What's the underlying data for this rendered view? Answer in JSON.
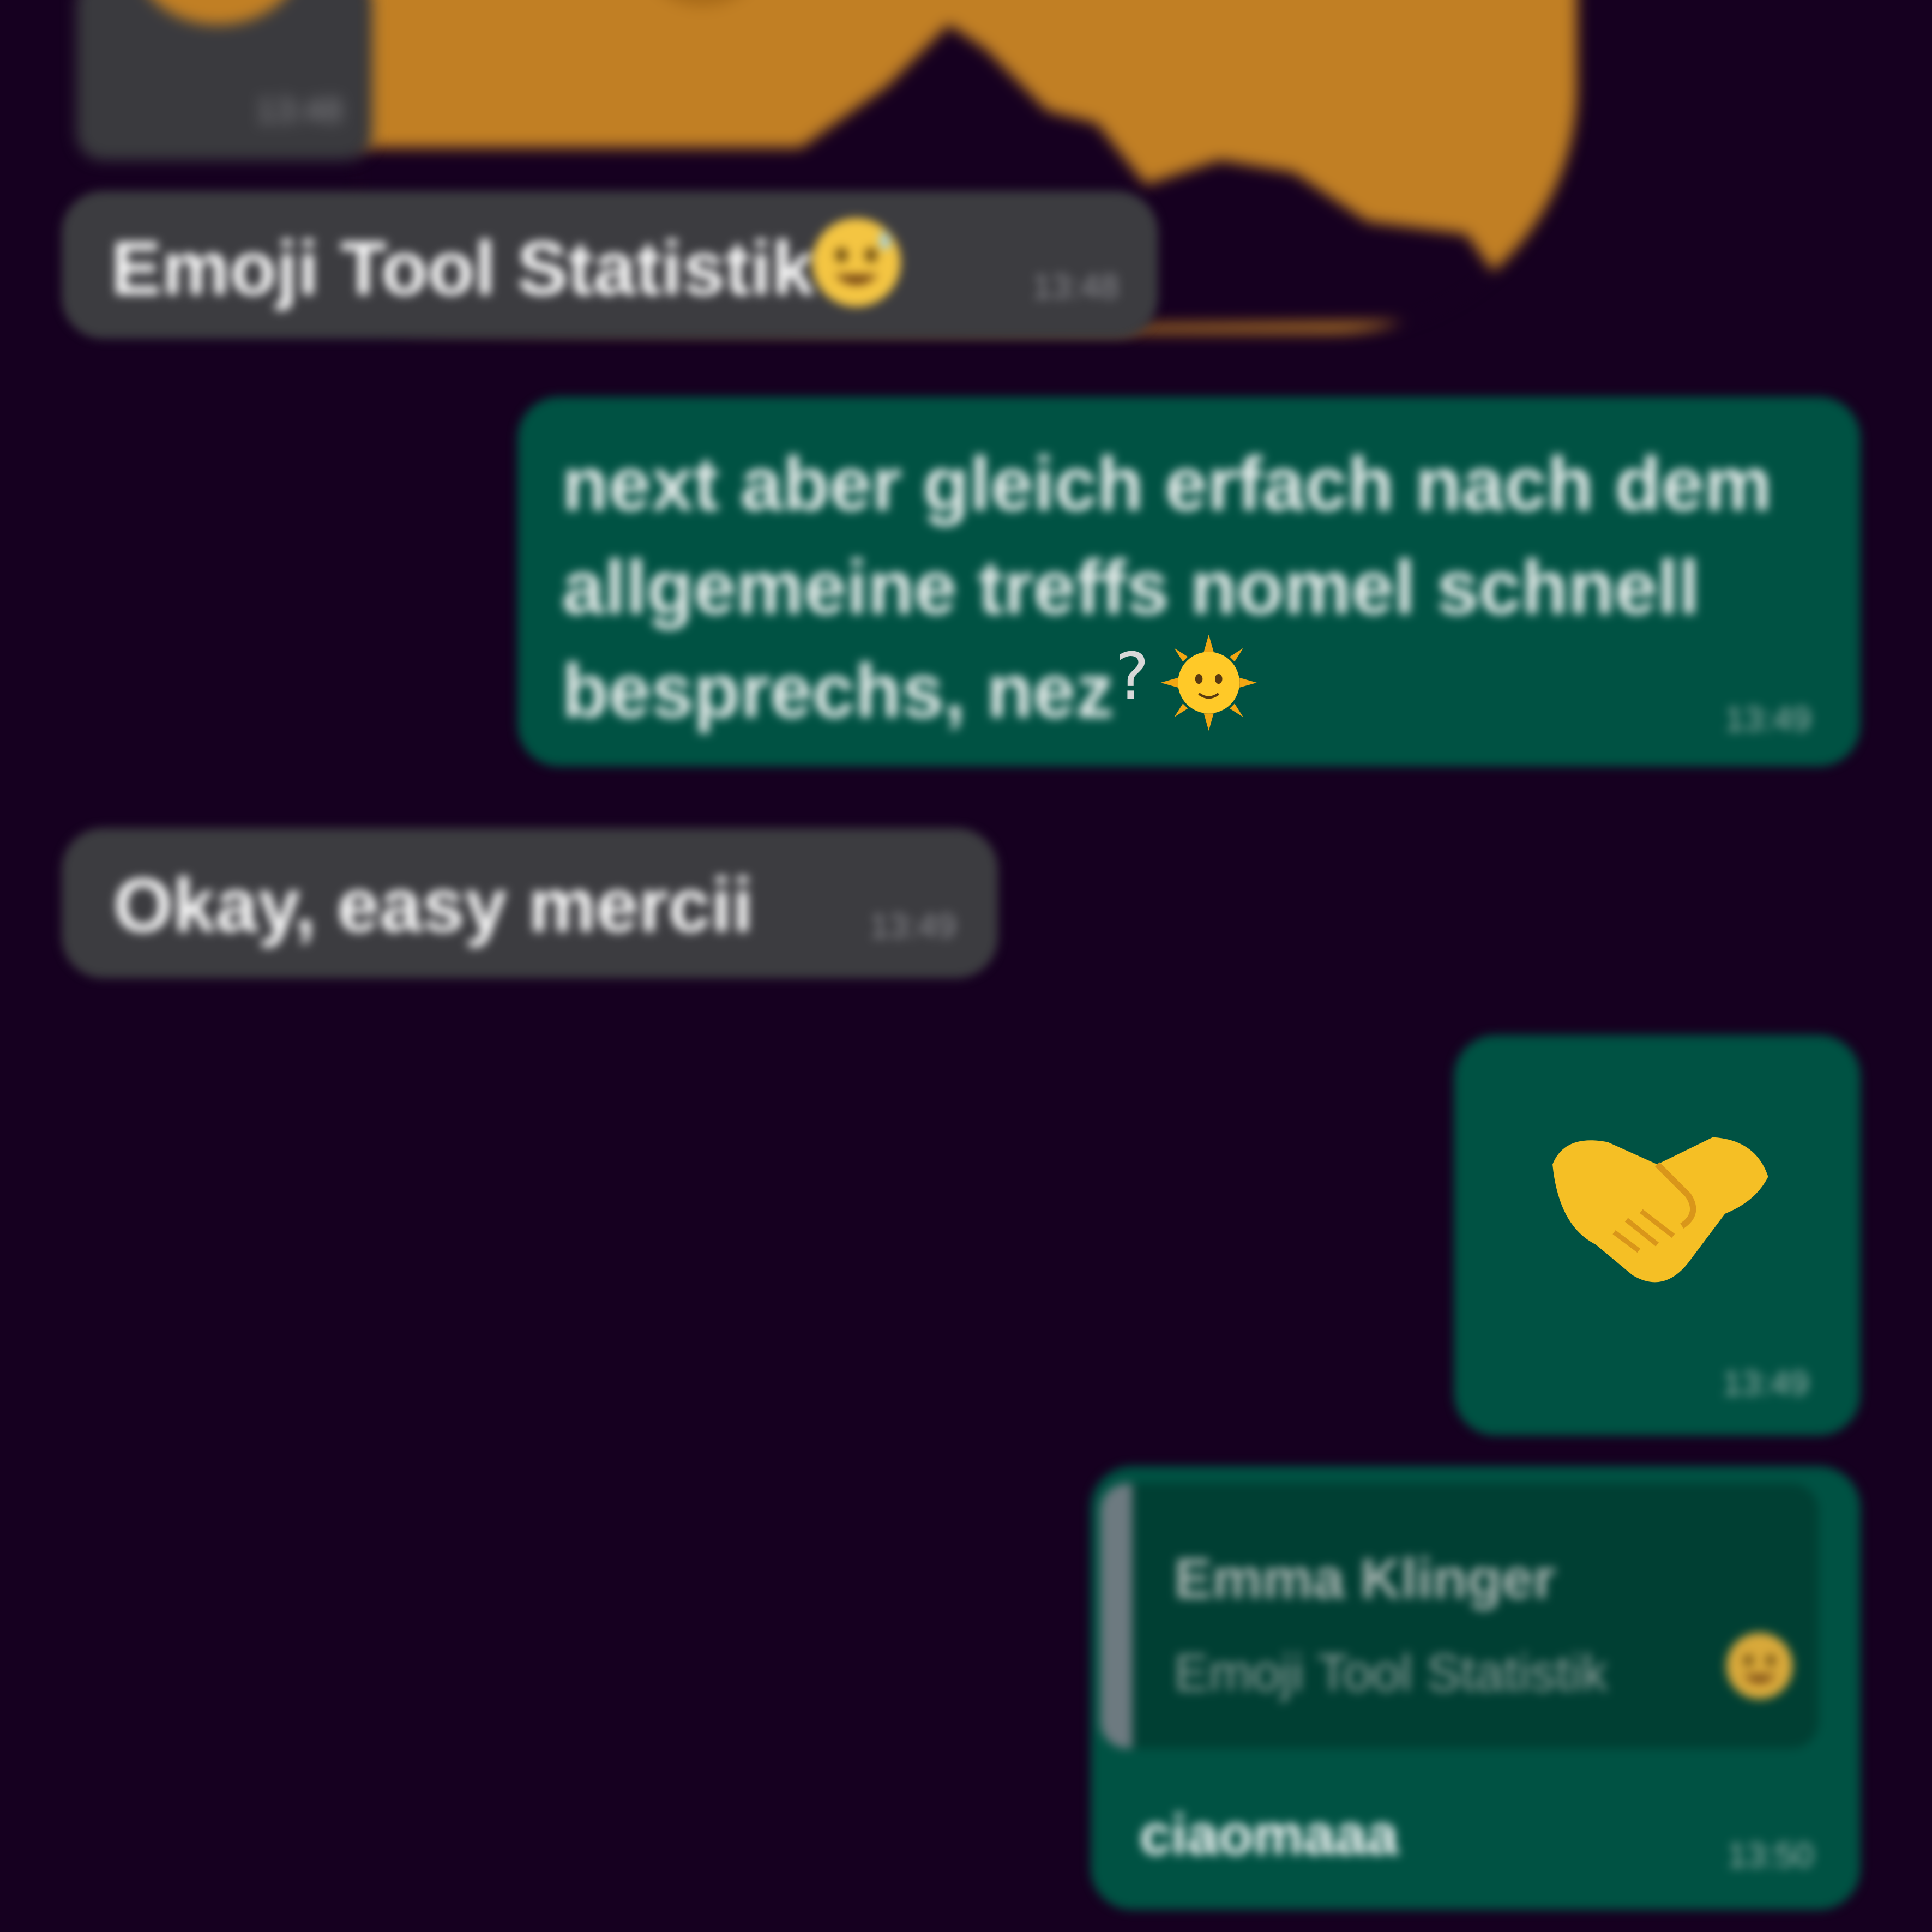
{
  "colors": {
    "background": "#160020",
    "incoming_bubble": "#3c3c40",
    "outgoing_bubble": "#005243",
    "quote_background": "#003f33",
    "sticker_orange": "#c17f24"
  },
  "top_avatar_tile": {
    "time": "13:48"
  },
  "messages": [
    {
      "direction": "incoming",
      "text": "Emoji Tool Statistik",
      "emoji": "grinning-sweat-emoji",
      "time": "13:48"
    },
    {
      "direction": "outgoing",
      "text": "next aber gleich erfach nach dem allgemeine treffs nomel schnell besprechs, nez",
      "clear_text": "?",
      "emoji": "sun-with-face-emoji",
      "time": "13:49"
    },
    {
      "direction": "incoming",
      "text": "Okay, easy mercii",
      "time": "13:49"
    },
    {
      "direction": "outgoing",
      "emoji": "handshake-emoji",
      "time": "13:49"
    },
    {
      "direction": "outgoing",
      "quote_author": "Emma Klinger",
      "quote_text": "Emoji Tool Statistik",
      "quote_emoji": "grinning-sweat-emoji",
      "text": "ciaomaaa",
      "time": "13:50"
    }
  ]
}
